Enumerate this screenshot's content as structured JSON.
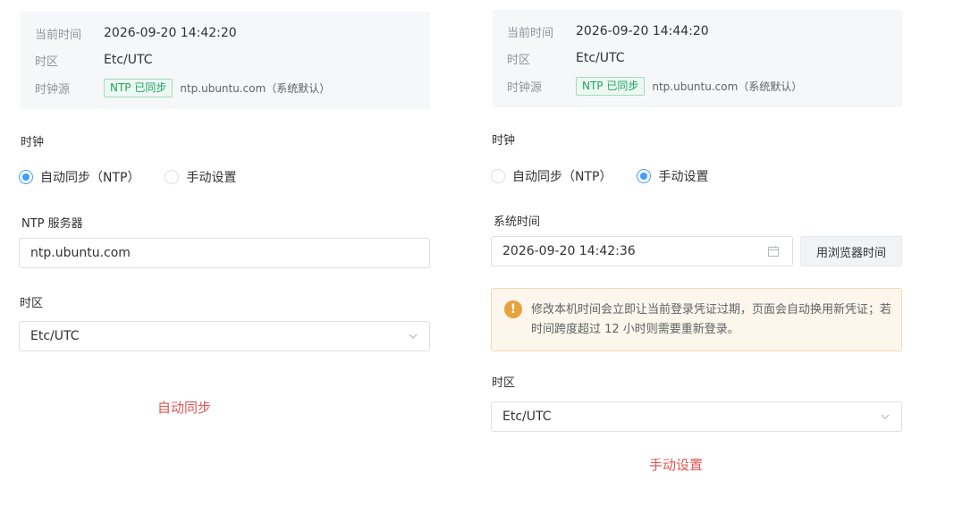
{
  "left": {
    "info": {
      "current_time_label": "当前时间",
      "current_time_value": "2026-09-20 14:42:20",
      "timezone_label": "时区",
      "timezone_value": "Etc/UTC",
      "clock_source_label": "时钟源",
      "ntp_badge": "NTP 已同步",
      "source_text": "ntp.ubuntu.com（系统默认）"
    },
    "clock_label": "时钟",
    "radio_auto": "自动同步（NTP）",
    "radio_manual": "手动设置",
    "selected_mode": "auto",
    "ntp_server_label": "NTP 服务器",
    "ntp_server_value": "ntp.ubuntu.com",
    "timezone_label": "时区",
    "timezone_value": "Etc/UTC",
    "caption": "自动同步"
  },
  "right": {
    "info": {
      "current_time_label": "当前时间",
      "current_time_value": "2026-09-20 14:44:20",
      "timezone_label": "时区",
      "timezone_value": "Etc/UTC",
      "clock_source_label": "时钟源",
      "ntp_badge": "NTP 已同步",
      "source_text": "ntp.ubuntu.com（系统默认）"
    },
    "clock_label": "时钟",
    "radio_auto": "自动同步（NTP）",
    "radio_manual": "手动设置",
    "selected_mode": "manual",
    "system_time_label": "系统时间",
    "system_time_value": "2026-09-20 14:42:36",
    "browser_time_button": "用浏览器时间",
    "warning_text": "修改本机时间会立即让当前登录凭证过期，页面会自动换用新凭证；若时间跨度超过 12 小时则需要重新登录。",
    "timezone_label": "时区",
    "timezone_value": "Etc/UTC",
    "caption": "手动设置"
  },
  "colors": {
    "accent": "#409eff",
    "ntp_badge_green": "#21a366",
    "warning": "#e6a23c",
    "caption_red": "#e05555"
  },
  "icons": {
    "dropdown": "chevron-down-icon",
    "calendar": "calendar-icon",
    "warning": "warning-icon"
  }
}
